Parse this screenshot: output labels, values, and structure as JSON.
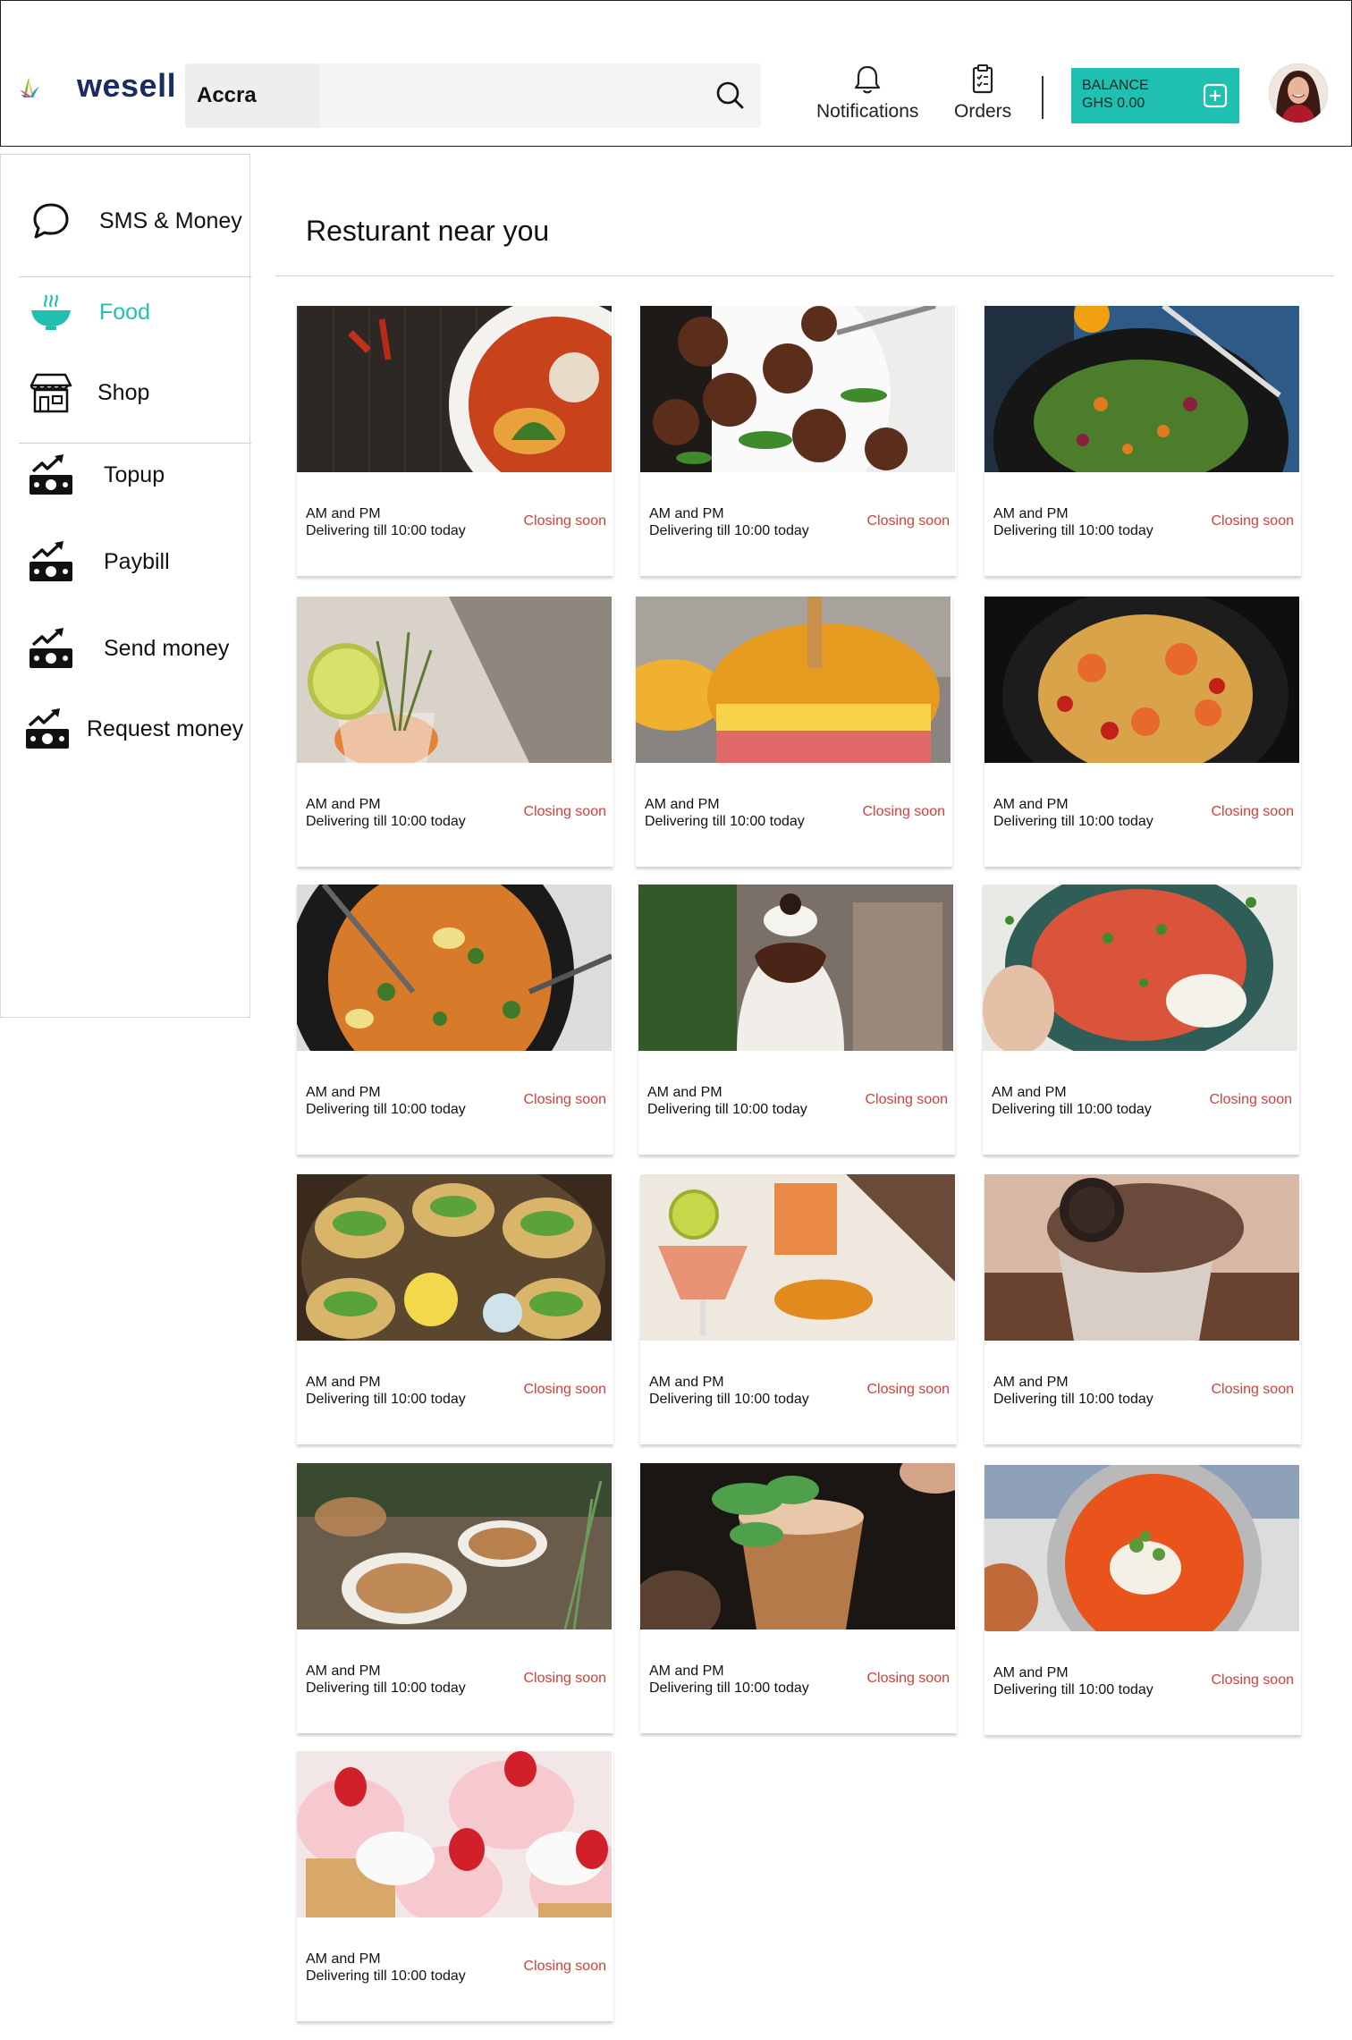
{
  "header": {
    "brand": "wesell",
    "search": {
      "location": "Accra",
      "placeholder": ""
    },
    "notifications_label": "Notifications",
    "orders_label": "Orders",
    "balance": {
      "label": "BALANCE",
      "amount": "GHS 0.00"
    },
    "icons": {
      "search": "search-icon",
      "notifications": "bell-icon",
      "orders": "clipboard-icon",
      "add": "plus-square-icon"
    }
  },
  "sidebar": {
    "items": [
      {
        "label": "SMS & Money",
        "icon": "chat-bubble-icon"
      },
      {
        "label": "Food",
        "icon": "bowl-icon",
        "active": true
      },
      {
        "label": "Shop",
        "icon": "storefront-icon"
      },
      {
        "label": "Topup",
        "icon": "money-growth-icon"
      },
      {
        "label": "Paybill",
        "icon": "money-growth-icon"
      },
      {
        "label": "Send money",
        "icon": "money-growth-icon"
      },
      {
        "label": "Request money",
        "icon": "money-growth-icon"
      }
    ]
  },
  "main": {
    "title": "Resturant near you",
    "restaurants": [
      {
        "name": "AM and PM",
        "delivery": "Delivering till 10:00 today",
        "status": "Closing soon",
        "image": "soup-bowl"
      },
      {
        "name": "AM and PM",
        "delivery": "Delivering till 10:00 today",
        "status": "Closing soon",
        "image": "meatballs"
      },
      {
        "name": "AM and PM",
        "delivery": "Delivering till 10:00 today",
        "status": "Closing soon",
        "image": "salad-plate"
      },
      {
        "name": "AM and PM",
        "delivery": "Delivering till 10:00 today",
        "status": "Closing soon",
        "image": "cocktail-lime"
      },
      {
        "name": "AM and PM",
        "delivery": "Delivering till 10:00 today",
        "status": "Closing soon",
        "image": "burger"
      },
      {
        "name": "AM and PM",
        "delivery": "Delivering till 10:00 today",
        "status": "Closing soon",
        "image": "seafood-pasta"
      },
      {
        "name": "AM and PM",
        "delivery": "Delivering till 10:00 today",
        "status": "Closing soon",
        "image": "paella-pan"
      },
      {
        "name": "AM and PM",
        "delivery": "Delivering till 10:00 today",
        "status": "Closing soon",
        "image": "chocolate-parfait"
      },
      {
        "name": "AM and PM",
        "delivery": "Delivering till 10:00 today",
        "status": "Closing soon",
        "image": "rice-bowl"
      },
      {
        "name": "AM and PM",
        "delivery": "Delivering till 10:00 today",
        "status": "Closing soon",
        "image": "tacos-platter"
      },
      {
        "name": "AM and PM",
        "delivery": "Delivering till 10:00 today",
        "status": "Closing soon",
        "image": "orange-cocktails"
      },
      {
        "name": "AM and PM",
        "delivery": "Delivering till 10:00 today",
        "status": "Closing soon",
        "image": "oreo-shake"
      },
      {
        "name": "AM and PM",
        "delivery": "Delivering till 10:00 today",
        "status": "Closing soon",
        "image": "latte-cups"
      },
      {
        "name": "AM and PM",
        "delivery": "Delivering till 10:00 today",
        "status": "Closing soon",
        "image": "mint-drink"
      },
      {
        "name": "AM and PM",
        "delivery": "Delivering till 10:00 today",
        "status": "Closing soon",
        "image": "tomato-soup"
      },
      {
        "name": "AM and PM",
        "delivery": "Delivering till 10:00 today",
        "status": "Closing soon",
        "image": "strawberry-cupcakes"
      }
    ]
  },
  "colors": {
    "accent": "#1fc0b1",
    "status": "#d0403a",
    "brand_text": "#1b2c62"
  }
}
